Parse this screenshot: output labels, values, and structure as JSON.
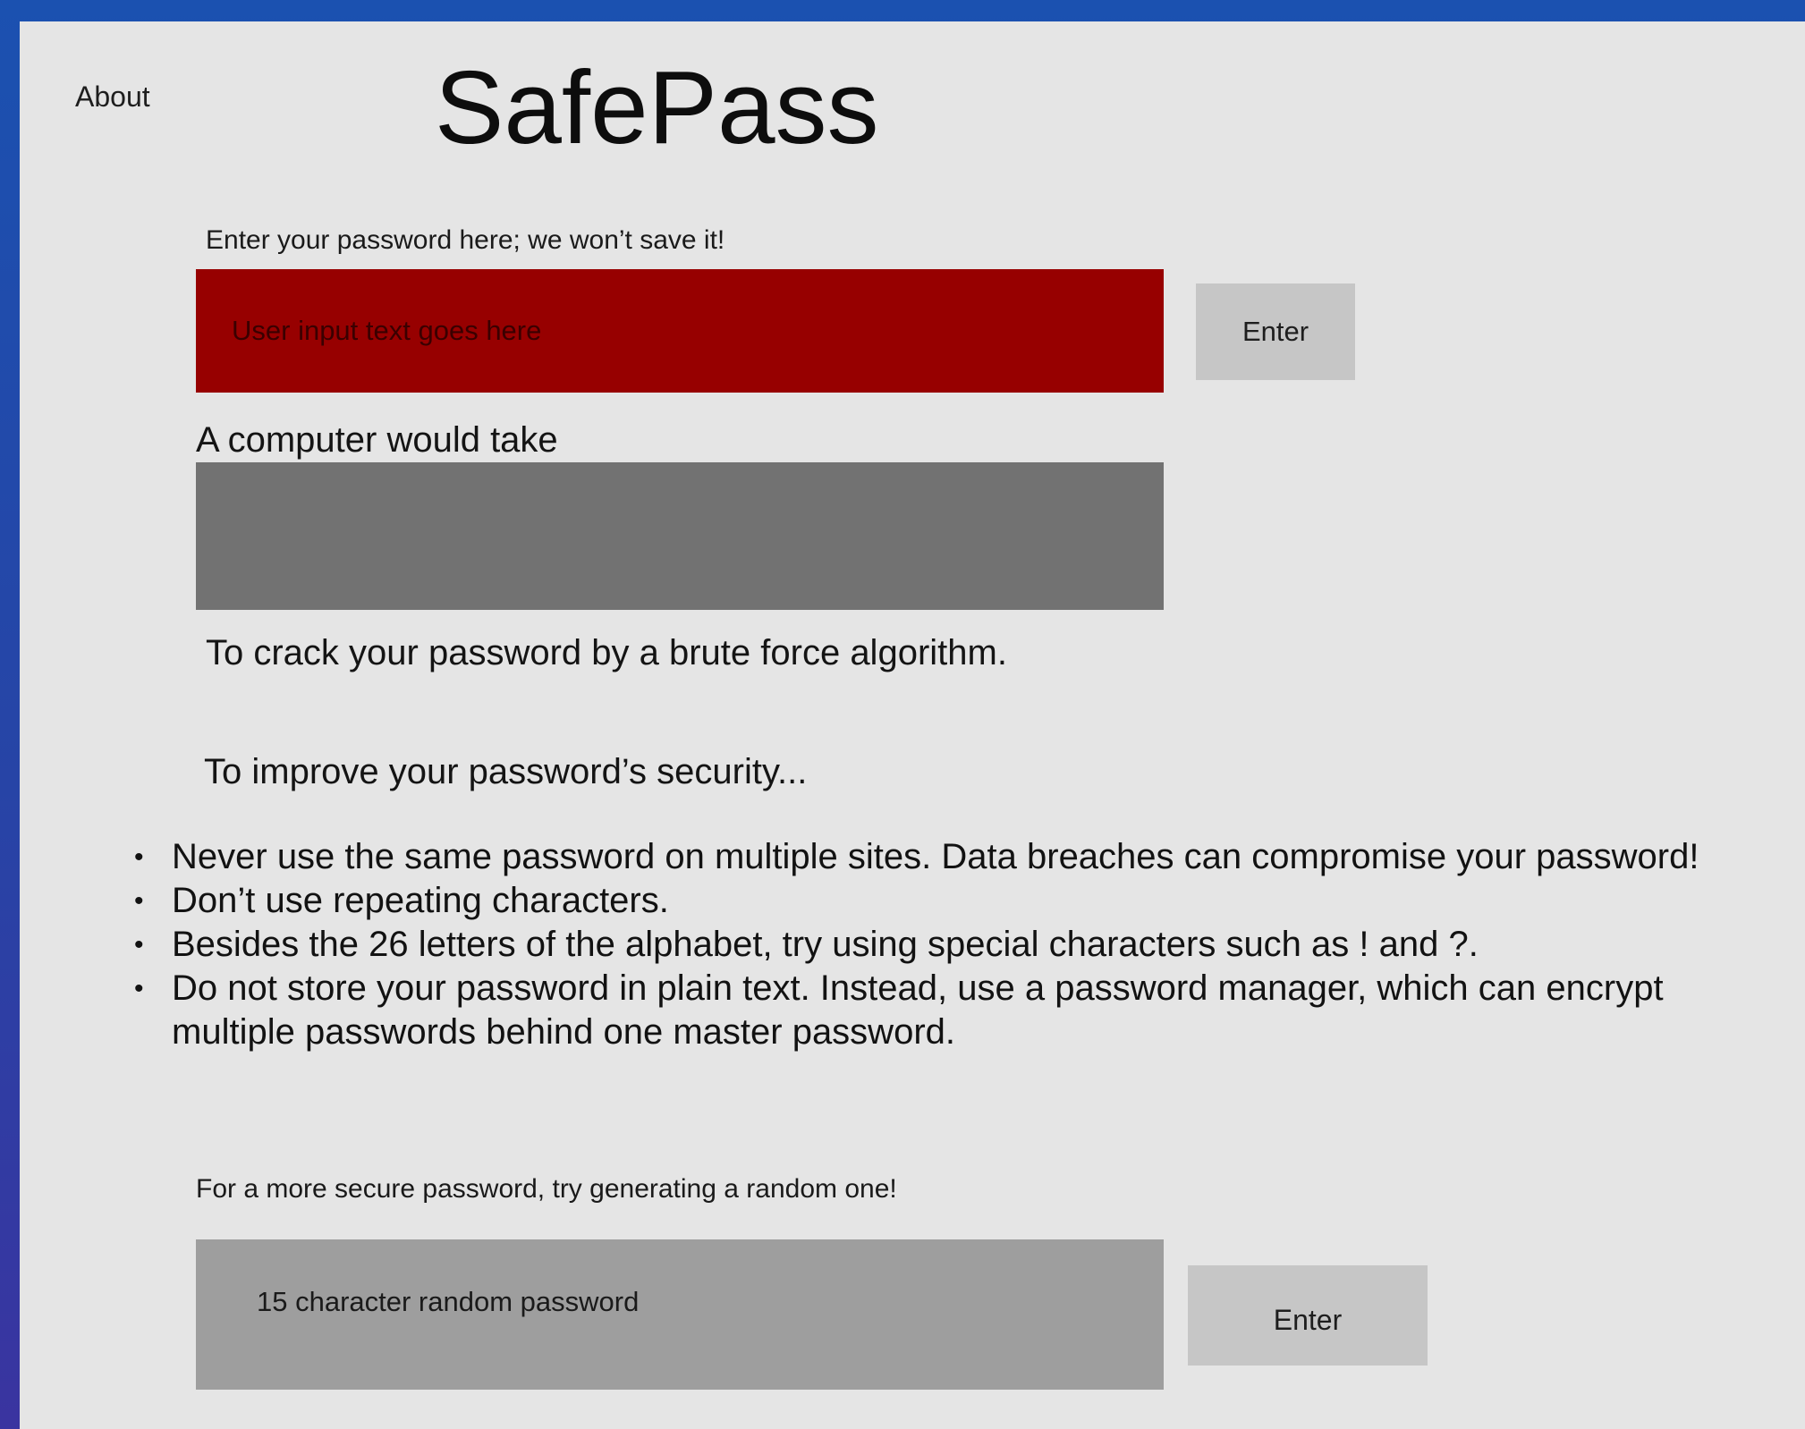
{
  "header": {
    "about_link": "About",
    "title": "SafePass"
  },
  "password_check": {
    "label": "Enter your password here; we won’t save it!",
    "input_placeholder": "User input text goes here",
    "input_value": "",
    "enter_label": "Enter",
    "input_color": "#970000"
  },
  "result": {
    "label": "A computer would take",
    "time_value": "",
    "suffix": "To crack your password by a brute force algorithm."
  },
  "tips": {
    "heading": "To improve your password’s security...",
    "items": [
      "Never use the same password on multiple sites. Data breaches can compromise your password!",
      "Don’t use repeating characters.",
      "Besides the 26 letters of the alphabet, try using special characters such as ! and ?.",
      "Do not store your password in plain text. Instead, use a password manager, which can encrypt multiple passwords behind one master password."
    ]
  },
  "generator": {
    "label": "For a more secure password, try generating a random one!",
    "output_text": "15 character random password",
    "enter_label": "Enter"
  }
}
